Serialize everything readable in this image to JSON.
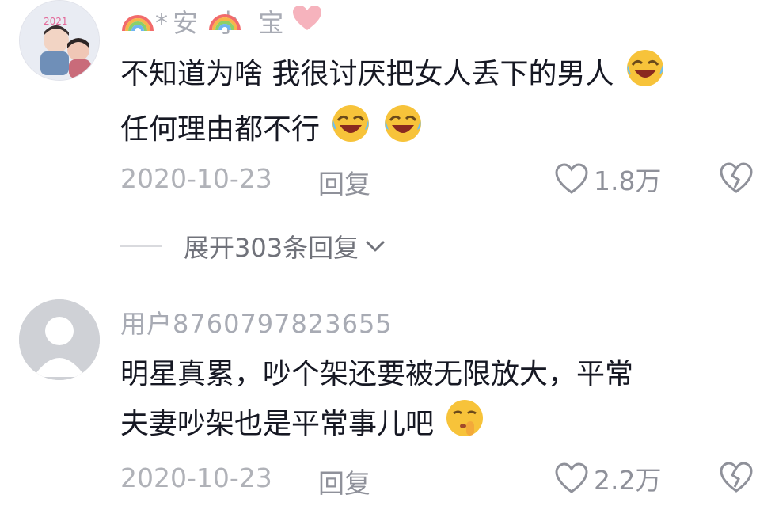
{
  "comments": [
    {
      "username": "*安 小 宝",
      "text_lines": [
        "不知道为啥 我很讨厌把女人丢下的男人",
        "任何理由都不行"
      ],
      "date": "2020-10-23",
      "reply_label": "回复",
      "likes": "1.8万",
      "expand_label": "展开303条回复",
      "icons": [
        "rainbow-icon",
        "heart-icon",
        "laughing-crying-emoji-icon",
        "chevron-down-icon"
      ]
    },
    {
      "username": "用户8760797823655",
      "text_lines": [
        "明星真累，吵个架还要被无限放大，平常",
        "夫妻吵架也是平常事儿吧"
      ],
      "date": "2020-10-23",
      "reply_label": "回复",
      "likes": "2.2万",
      "icons": [
        "default-avatar-icon",
        "shushing-face-emoji-icon"
      ]
    }
  ],
  "colors": {
    "text": "#161823",
    "muted": "#a8abb4",
    "action": "#8f919a",
    "heart_pink": "#f6b3bd"
  }
}
